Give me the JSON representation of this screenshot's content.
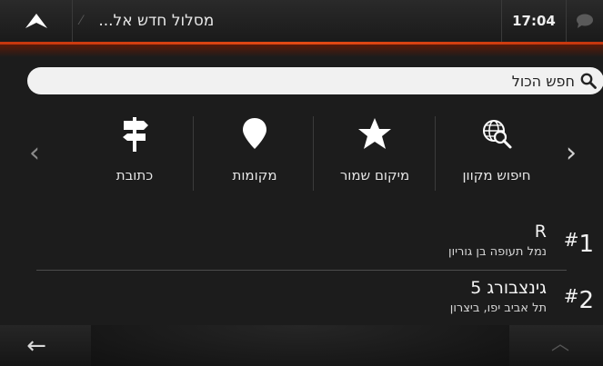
{
  "topbar": {
    "route_title": "מסלול חדש אל...",
    "time": "17:04"
  },
  "search": {
    "text": "חפש הכול"
  },
  "categories": [
    {
      "label": "חיפוש מקוון",
      "icon": "globe-search-icon"
    },
    {
      "label": "מיקום שמור",
      "icon": "star-icon"
    },
    {
      "label": "מקומות",
      "icon": "map-pin-icon"
    },
    {
      "label": "כתובת",
      "icon": "signpost-icon"
    }
  ],
  "results": [
    {
      "num": "1",
      "title": "R",
      "subtitle": "נמל תעופה בן גוריון"
    },
    {
      "num": "2",
      "title": "גינצבורג 5",
      "subtitle": "תל אביב יפו, ביצרון"
    }
  ],
  "colors": {
    "accent": "#e24a14",
    "background": "#1c1c1c"
  }
}
